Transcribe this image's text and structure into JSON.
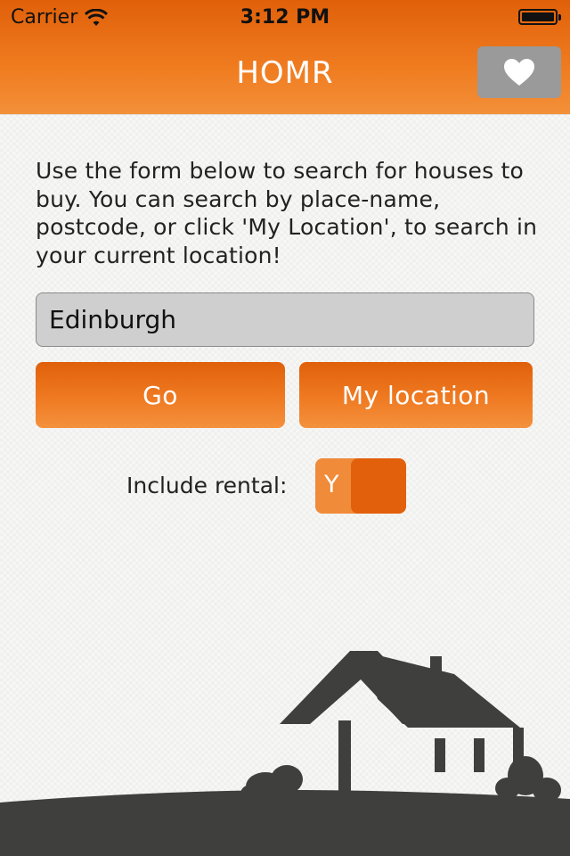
{
  "status_bar": {
    "carrier": "Carrier",
    "wifi_icon": "wifi-icon",
    "time": "3:12 PM",
    "battery_icon": "battery-icon",
    "battery_level": 1.0
  },
  "nav": {
    "title": "HOMR",
    "favourites_icon": "heart-icon"
  },
  "intro": {
    "text": "Use the form below to search for houses to buy. You can search by place-name, postcode, or click 'My Location', to search in your current location!"
  },
  "search": {
    "value": "Edinburgh",
    "placeholder": ""
  },
  "buttons": {
    "go_label": "Go",
    "my_location_label": "My location"
  },
  "rental": {
    "label": "Include rental:",
    "toggle_text": "Y",
    "toggle_on": true
  },
  "colors": {
    "accent": "#e0600a",
    "accent_light": "#f3903a",
    "fav_button": "#9a9a9a",
    "silhouette": "#3f3f3d"
  }
}
